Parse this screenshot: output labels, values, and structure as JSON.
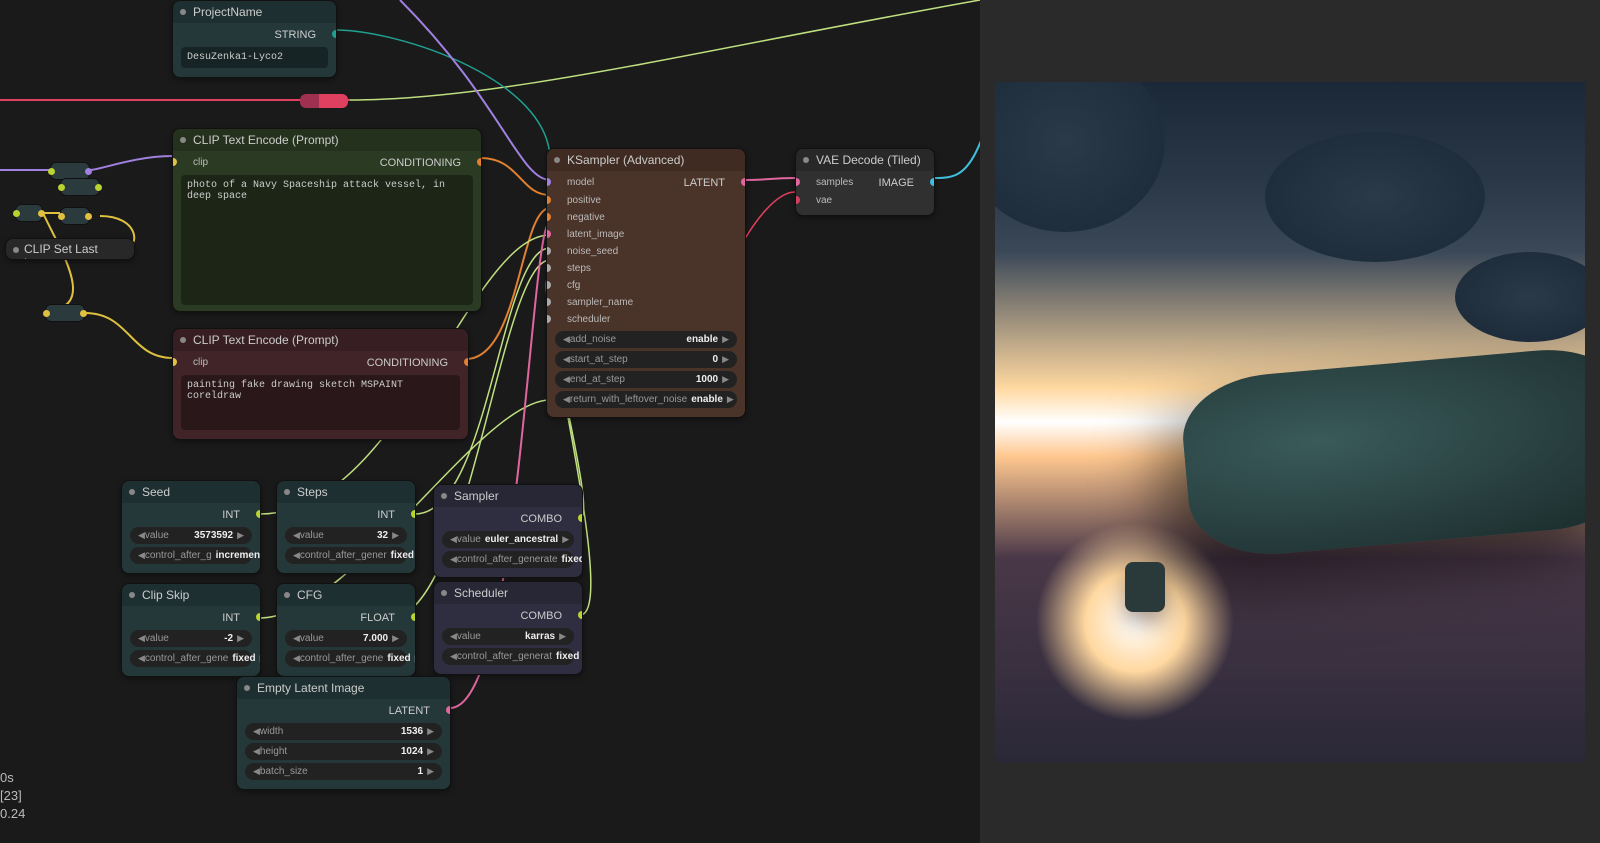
{
  "project_name": {
    "title": "ProjectName",
    "output": "STRING",
    "value": "DesuZenka1-Lyco2"
  },
  "clip_last_layer": {
    "title": "CLIP Set Last Layer"
  },
  "clip_pos": {
    "title": "CLIP Text Encode (Prompt)",
    "input": "clip",
    "output": "CONDITIONING",
    "text": "photo of a Navy Spaceship attack vessel, in deep space"
  },
  "clip_neg": {
    "title": "CLIP Text Encode (Prompt)",
    "input": "clip",
    "output": "CONDITIONING",
    "text": "painting fake drawing sketch MSPAINT coreldraw"
  },
  "ksampler": {
    "title": "KSampler (Advanced)",
    "inputs": [
      "model",
      "positive",
      "negative",
      "latent_image",
      "noise_seed",
      "steps",
      "cfg",
      "sampler_name",
      "scheduler"
    ],
    "output": "LATENT",
    "widgets": [
      {
        "label": "add_noise",
        "value": "enable"
      },
      {
        "label": "start_at_step",
        "value": "0"
      },
      {
        "label": "end_at_step",
        "value": "1000"
      },
      {
        "label": "return_with_leftover_noise",
        "value": "enable"
      }
    ]
  },
  "vae": {
    "title": "VAE Decode (Tiled)",
    "inputs": [
      "samples",
      "vae"
    ],
    "output": "IMAGE"
  },
  "seed": {
    "title": "Seed",
    "output": "INT",
    "value_label": "value",
    "value": "3573592",
    "cag_label": "control_after_g",
    "cag_value": "increment"
  },
  "steps": {
    "title": "Steps",
    "output": "INT",
    "value_label": "value",
    "value": "32",
    "cag_label": "control_after_gener",
    "cag_value": "fixed"
  },
  "sampler": {
    "title": "Sampler",
    "output": "COMBO",
    "value_label": "value",
    "value": "euler_ancestral",
    "cag_label": "control_after_generate",
    "cag_value": "fixed"
  },
  "clip_skip": {
    "title": "Clip Skip",
    "output": "INT",
    "value_label": "value",
    "value": "-2",
    "cag_label": "control_after_gene",
    "cag_value": "fixed"
  },
  "cfg": {
    "title": "CFG",
    "output": "FLOAT",
    "value_label": "value",
    "value": "7.000",
    "cag_label": "control_after_gene",
    "cag_value": "fixed"
  },
  "scheduler": {
    "title": "Scheduler",
    "output": "COMBO",
    "value_label": "value",
    "value": "karras",
    "cag_label": "control_after_generat",
    "cag_value": "fixed"
  },
  "latent": {
    "title": "Empty Latent Image",
    "output": "LATENT",
    "widgets": [
      {
        "label": "width",
        "value": "1536"
      },
      {
        "label": "height",
        "value": "1024"
      },
      {
        "label": "batch_size",
        "value": "1"
      }
    ]
  },
  "debug": {
    "line1": "0s",
    "line2": "[23]",
    "line3": "0.24"
  }
}
